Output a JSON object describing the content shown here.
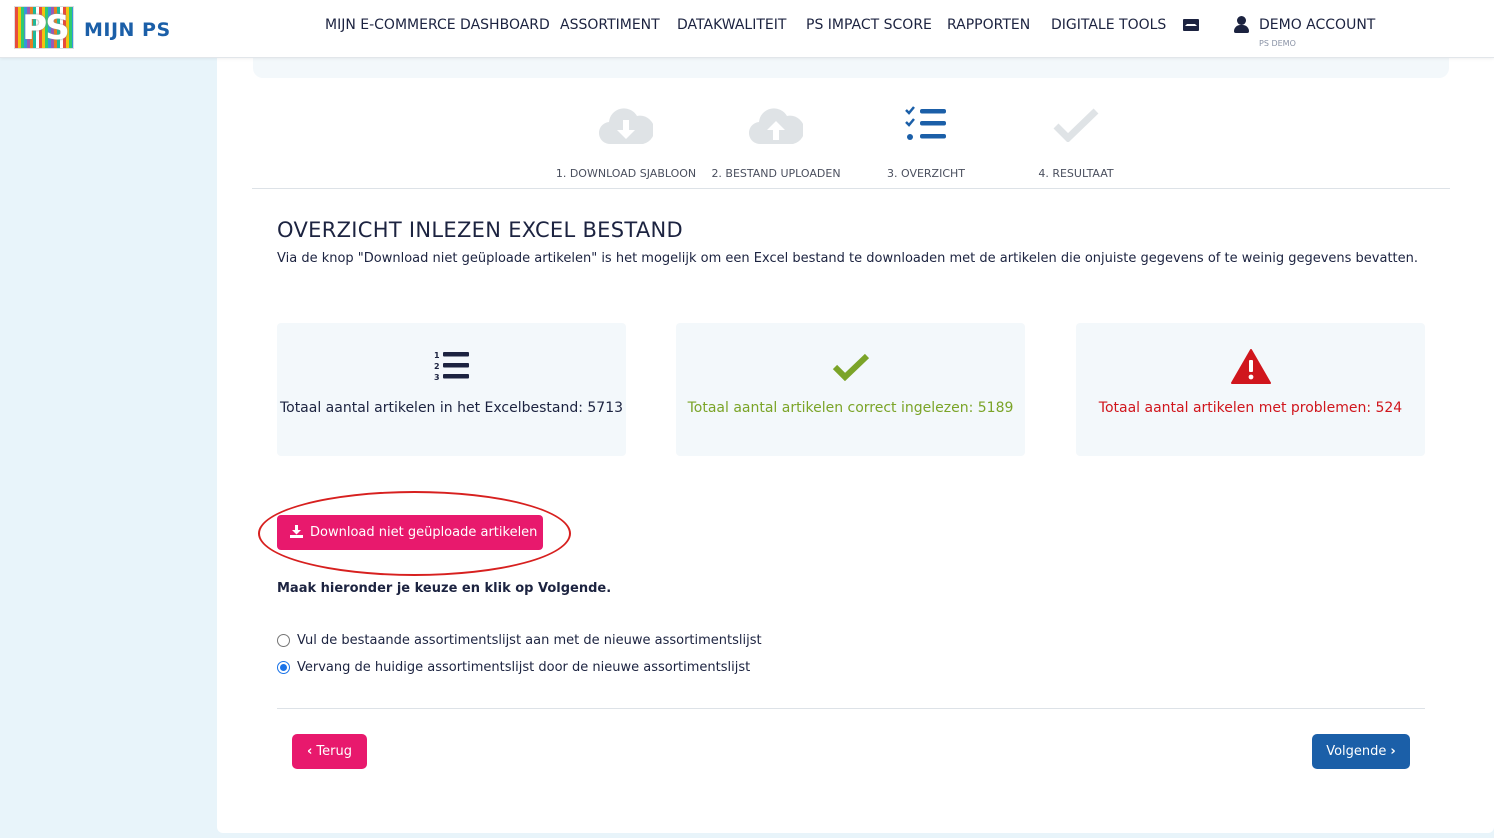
{
  "header": {
    "logo_text": "PS",
    "brand": "MIJN PS",
    "nav": [
      {
        "label": "MIJN E-COMMERCE DASHBOARD"
      },
      {
        "label": "ASSORTIMENT"
      },
      {
        "label": "DATAKWALITEIT"
      },
      {
        "label": "PS IMPACT SCORE"
      },
      {
        "label": "RAPPORTEN"
      },
      {
        "label": "DIGITALE TOOLS"
      }
    ],
    "mail_icon": "envelope-icon",
    "user_icon": "user-icon",
    "account": "DEMO ACCOUNT",
    "account_sub": "PS DEMO"
  },
  "steps": [
    {
      "label": "1. DOWNLOAD SJABLOON",
      "icon": "cloud-download-icon",
      "state": "inactive"
    },
    {
      "label": "2. BESTAND UPLOADEN",
      "icon": "cloud-upload-icon",
      "state": "inactive"
    },
    {
      "label": "3. OVERZICHT",
      "icon": "checklist-icon",
      "state": "active"
    },
    {
      "label": "4. RESULTAAT",
      "icon": "check-icon",
      "state": "inactive"
    }
  ],
  "main": {
    "title": "OVERZICHT INLEZEN EXCEL BESTAND",
    "description": "Via de knop \"Download niet geüploade artikelen\" is het mogelijk om een Excel bestand te downloaden met de artikelen die onjuiste gegevens of te weinig gegevens bevatten."
  },
  "cards": [
    {
      "icon": "numbered-list-icon",
      "text": "Totaal aantal artikelen in het Excelbestand: 5713",
      "color": "#1c2340"
    },
    {
      "icon": "check-icon",
      "text": "Totaal aantal artikelen correct ingelezen: 5189",
      "color": "#7ba428"
    },
    {
      "icon": "warning-icon",
      "text": "Totaal aantal artikelen met problemen: 524",
      "color": "#d0161d"
    }
  ],
  "download_button": {
    "label": "Download niet geüploade artikelen",
    "icon": "download-icon"
  },
  "instruction": "Maak hieronder je keuze en klik op Volgende.",
  "options": [
    {
      "label": "Vul de bestaande assortimentslijst aan met de nieuwe assortimentslijst",
      "checked": false
    },
    {
      "label": "Vervang de huidige assortimentslijst door de nieuwe assortimentslijst",
      "checked": true
    }
  ],
  "buttons": {
    "back": "Terug",
    "next": "Volgende"
  },
  "colors": {
    "brand_blue": "#1b5fa8",
    "accent_pink": "#e8196d",
    "success": "#7ba428",
    "danger": "#d0161d",
    "highlight": "#d7201f"
  }
}
